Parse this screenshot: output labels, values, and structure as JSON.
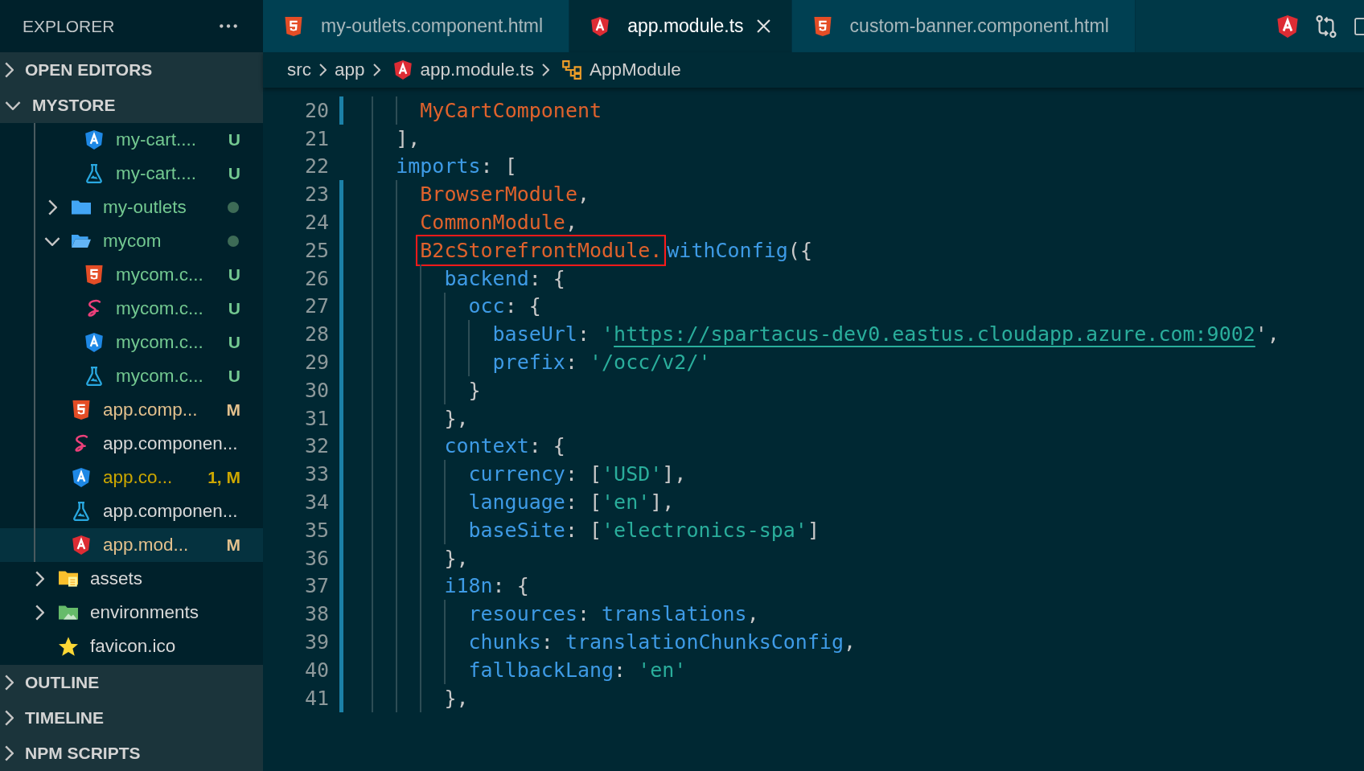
{
  "explorer": {
    "title": "EXPLORER"
  },
  "sections_top": [
    {
      "label": "OPEN EDITORS",
      "expanded": false
    },
    {
      "label": "MYSTORE",
      "expanded": true
    }
  ],
  "tree": [
    {
      "children": [
        {
          "children": [
            {
              "label": "my-cart....",
              "kind": "angular",
              "color": "#73c991",
              "badge": "U",
              "selected": false
            },
            {
              "label": "my-cart....",
              "kind": "test",
              "color": "#73c991",
              "badge": "U",
              "selected": false
            }
          ]
        },
        {
          "label": "my-outlets",
          "kind": "folder",
          "expanded": false,
          "color": "#73c991",
          "dot": true,
          "selected": false
        },
        {
          "label": "mycom",
          "kind": "folder",
          "expanded": true,
          "color": "#73c991",
          "dot": true,
          "selected": false,
          "children": [
            {
              "label": "mycom.c...",
              "kind": "html",
              "color": "#73c991",
              "badge": "U",
              "selected": false
            },
            {
              "label": "mycom.c...",
              "kind": "sass",
              "color": "#73c991",
              "badge": "U",
              "selected": false
            },
            {
              "label": "mycom.c...",
              "kind": "angular",
              "color": "#73c991",
              "badge": "U",
              "selected": false
            },
            {
              "label": "mycom.c...",
              "kind": "test",
              "color": "#73c991",
              "badge": "U",
              "selected": false
            }
          ]
        },
        {
          "label": "app.comp...",
          "kind": "html",
          "color": "#e2c08d",
          "badge": "M",
          "selected": false
        },
        {
          "label": "app.componen...",
          "kind": "sass",
          "selected": false
        },
        {
          "label": "app.co...",
          "kind": "angular",
          "color": "#cca700",
          "badge": "1, M",
          "selected": false
        },
        {
          "label": "app.componen...",
          "kind": "test",
          "selected": false
        },
        {
          "label": "app.mod...",
          "kind": "angular-red",
          "color": "#e2c08d",
          "badge": "M",
          "selected": true
        }
      ]
    },
    {
      "label": "assets",
      "kind": "folder-assets",
      "expanded": false,
      "selected": false
    },
    {
      "label": "environments",
      "kind": "folder-env",
      "expanded": false,
      "selected": false
    },
    {
      "label": "favicon.ico",
      "kind": "star",
      "selected": false
    }
  ],
  "sections_bottom": [
    {
      "label": "OUTLINE",
      "expanded": false
    },
    {
      "label": "TIMELINE",
      "expanded": false
    },
    {
      "label": "NPM SCRIPTS",
      "expanded": false
    }
  ],
  "tabs": [
    {
      "label": "my-outlets.component.html",
      "kind": "html",
      "selected": false
    },
    {
      "label": "app.module.ts",
      "kind": "angular-red",
      "selected": true
    },
    {
      "label": "custom-banner.component.html",
      "kind": "html",
      "selected": false
    }
  ],
  "breadcrumb": [
    {
      "label": "src"
    },
    {
      "label": "app"
    },
    {
      "label": "app.module.ts",
      "kind": "angular-red"
    },
    {
      "label": "AppModule",
      "kind": "class"
    }
  ],
  "code_lines": [
    {
      "children": [
        {
          "number": "20",
          "changed": true,
          "tokens": [
            {
              "text": "MyCartComponent",
              "kind": "class"
            }
          ]
        }
      ]
    },
    {
      "number": "21",
      "changed": false,
      "tokens": [
        {
          "text": "],",
          "kind": "punct"
        }
      ]
    },
    {
      "number": "22",
      "changed": false,
      "tokens": [
        {
          "text": "imports",
          "kind": "prop"
        },
        {
          "text": ": [",
          "kind": "punct"
        }
      ],
      "children": [
        {
          "number": "23",
          "changed": true,
          "tokens": [
            {
              "text": "BrowserModule",
              "kind": "class"
            },
            {
              "text": ",",
              "kind": "punct"
            }
          ]
        },
        {
          "number": "24",
          "changed": true,
          "tokens": [
            {
              "text": "CommonModule",
              "kind": "class"
            },
            {
              "text": ",",
              "kind": "punct"
            }
          ]
        },
        {
          "number": "25",
          "changed": true,
          "tokens": [
            {
              "text": "B2cStorefrontModule.",
              "kind": "class",
              "boxed": true
            },
            {
              "text": "withConfig",
              "kind": "prop"
            },
            {
              "text": "({",
              "kind": "punct"
            }
          ],
          "children": [
            {
              "number": "26",
              "changed": true,
              "tokens": [
                {
                  "text": "backend",
                  "kind": "prop"
                },
                {
                  "text": ": {",
                  "kind": "punct"
                }
              ],
              "children": [
                {
                  "number": "27",
                  "changed": true,
                  "tokens": [
                    {
                      "text": "occ",
                      "kind": "prop"
                    },
                    {
                      "text": ": {",
                      "kind": "punct"
                    }
                  ],
                  "children": [
                    {
                      "number": "28",
                      "changed": true,
                      "tokens": [
                        {
                          "text": "baseUrl",
                          "kind": "prop"
                        },
                        {
                          "text": ": ",
                          "kind": "punct"
                        },
                        {
                          "text": "'",
                          "kind": "string"
                        },
                        {
                          "text": "https://spartacus-dev0.eastus.cloudapp.azure.com:9002",
                          "kind": "link"
                        },
                        {
                          "text": "',",
                          "kind": "punct"
                        }
                      ]
                    },
                    {
                      "number": "29",
                      "changed": true,
                      "tokens": [
                        {
                          "text": "prefix",
                          "kind": "prop"
                        },
                        {
                          "text": ": ",
                          "kind": "punct"
                        },
                        {
                          "text": "'/occ/v2/'",
                          "kind": "string"
                        }
                      ]
                    }
                  ]
                },
                {
                  "number": "30",
                  "changed": true,
                  "tokens": [
                    {
                      "text": "}",
                      "kind": "punct"
                    }
                  ]
                }
              ]
            },
            {
              "number": "31",
              "changed": true,
              "tokens": [
                {
                  "text": "},",
                  "kind": "punct"
                }
              ]
            },
            {
              "number": "32",
              "changed": true,
              "tokens": [
                {
                  "text": "context",
                  "kind": "prop"
                },
                {
                  "text": ": {",
                  "kind": "punct"
                }
              ],
              "children": [
                {
                  "number": "33",
                  "changed": true,
                  "tokens": [
                    {
                      "text": "currency",
                      "kind": "prop"
                    },
                    {
                      "text": ": [",
                      "kind": "punct"
                    },
                    {
                      "text": "'USD'",
                      "kind": "string"
                    },
                    {
                      "text": "],",
                      "kind": "punct"
                    }
                  ]
                },
                {
                  "number": "34",
                  "changed": true,
                  "tokens": [
                    {
                      "text": "language",
                      "kind": "prop"
                    },
                    {
                      "text": ": [",
                      "kind": "punct"
                    },
                    {
                      "text": "'en'",
                      "kind": "string"
                    },
                    {
                      "text": "],",
                      "kind": "punct"
                    }
                  ]
                },
                {
                  "number": "35",
                  "changed": true,
                  "tokens": [
                    {
                      "text": "baseSite",
                      "kind": "prop"
                    },
                    {
                      "text": ": [",
                      "kind": "punct"
                    },
                    {
                      "text": "'electronics-spa'",
                      "kind": "string"
                    },
                    {
                      "text": "]",
                      "kind": "punct"
                    }
                  ]
                }
              ]
            },
            {
              "number": "36",
              "changed": true,
              "tokens": [
                {
                  "text": "},",
                  "kind": "punct"
                }
              ]
            },
            {
              "number": "37",
              "changed": true,
              "tokens": [
                {
                  "text": "i18n",
                  "kind": "prop"
                },
                {
                  "text": ": {",
                  "kind": "punct"
                }
              ],
              "children": [
                {
                  "number": "38",
                  "changed": true,
                  "tokens": [
                    {
                      "text": "resources",
                      "kind": "prop"
                    },
                    {
                      "text": ": ",
                      "kind": "punct"
                    },
                    {
                      "text": "translations",
                      "kind": "prop"
                    },
                    {
                      "text": ",",
                      "kind": "punct"
                    }
                  ]
                },
                {
                  "number": "39",
                  "changed": true,
                  "tokens": [
                    {
                      "text": "chunks",
                      "kind": "prop"
                    },
                    {
                      "text": ": ",
                      "kind": "punct"
                    },
                    {
                      "text": "translationChunksConfig",
                      "kind": "prop"
                    },
                    {
                      "text": ",",
                      "kind": "punct"
                    }
                  ]
                },
                {
                  "number": "40",
                  "changed": true,
                  "tokens": [
                    {
                      "text": "fallbackLang",
                      "kind": "prop"
                    },
                    {
                      "text": ": ",
                      "kind": "punct"
                    },
                    {
                      "text": "'en'",
                      "kind": "string"
                    }
                  ]
                }
              ]
            },
            {
              "number": "41",
              "changed": true,
              "tokens": [
                {
                  "text": "},",
                  "kind": "punct"
                }
              ]
            }
          ]
        }
      ]
    }
  ]
}
